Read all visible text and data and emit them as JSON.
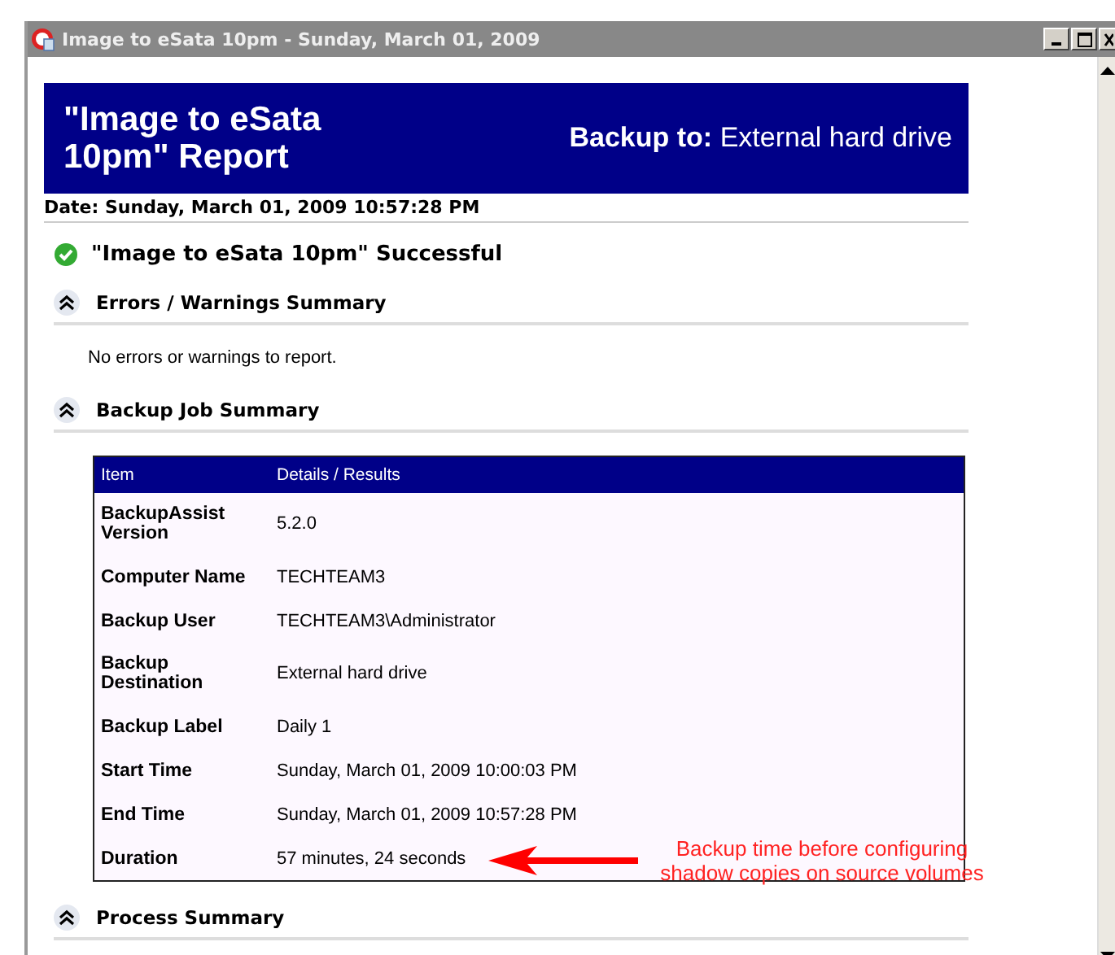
{
  "window": {
    "title": "Image to eSata 10pm - Sunday, March 01, 2009"
  },
  "banner": {
    "title": "\"Image to eSata 10pm\" Report",
    "backup_label": "Backup to:",
    "backup_value": "External hard drive"
  },
  "date": "Date: Sunday, March 01, 2009 10:57:28 PM",
  "status": {
    "kind": "success",
    "text": "\"Image to eSata 10pm\" Successful"
  },
  "sections": [
    {
      "title": "Errors / Warnings Summary",
      "expanded": true,
      "kind": "text",
      "text": "No errors or warnings to report."
    },
    {
      "title": "Backup Job Summary",
      "expanded": true,
      "kind": "table",
      "table": {
        "columns": [
          "Item",
          "Details / Results"
        ],
        "rows": [
          [
            "BackupAssist Version",
            "5.2.0"
          ],
          [
            "Computer Name",
            "TECHTEAM3"
          ],
          [
            "Backup User",
            "TECHTEAM3\\Administrator"
          ],
          [
            "Backup Destination",
            "External hard drive"
          ],
          [
            "Backup Label",
            "Daily 1"
          ],
          [
            "Start Time",
            "Sunday, March 01, 2009 10:00:03 PM"
          ],
          [
            "End Time",
            "Sunday, March 01, 2009 10:57:28 PM"
          ],
          [
            "Duration",
            "57 minutes, 24 seconds"
          ]
        ]
      }
    },
    {
      "title": "Process Summary",
      "expanded": true,
      "kind": "none"
    }
  ],
  "annotation": {
    "text": "Backup time before configuring shadow copies on source volumes"
  }
}
